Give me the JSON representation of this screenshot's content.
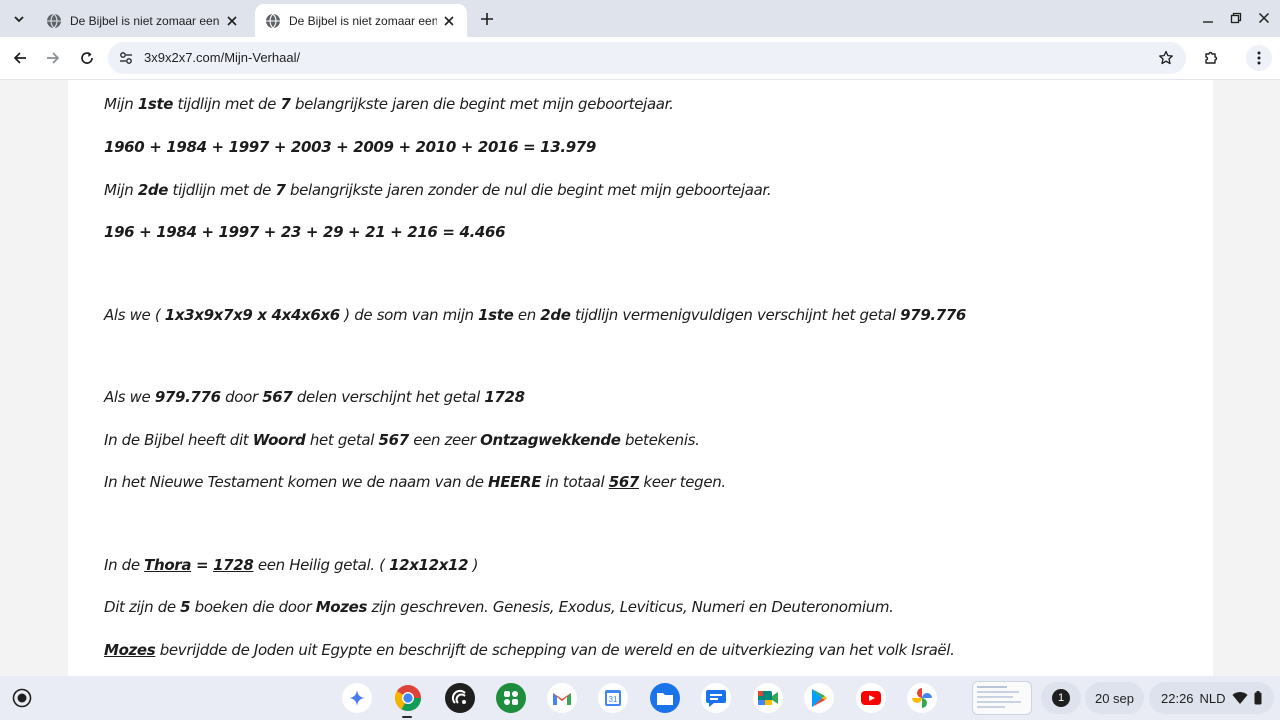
{
  "tabs": [
    {
      "title": "De Bijbel is niet zomaar een boek"
    },
    {
      "title": "De Bijbel is niet zomaar een boek"
    }
  ],
  "address": {
    "url": "3x9x2x7.com/Mijn-Verhaal/"
  },
  "shelf": {
    "date": "20 sep",
    "time": "22:26",
    "locale": "NLD",
    "notifications": "1",
    "calendar_day": "31"
  },
  "content": {
    "line1": {
      "a": "Mijn ",
      "b": "1ste",
      "c": " tijdlijn met de ",
      "d": "7",
      "e": " belangrijkste jaren die begint met mijn geboortejaar."
    },
    "line2": {
      "a": "1960 + 1984 + 1997 + 2003 + 2009 + 2010 + 2016 = 13.979"
    },
    "line3": {
      "a": "Mijn ",
      "b": "2de",
      "c": " tijdlijn met de ",
      "d": "7",
      "e": " belangrijkste jaren zonder de nul die begint met mijn geboortejaar."
    },
    "line4": {
      "a": "196 + 1984 + 1997 + 23 + 29 + 21 + 216 = 4.466"
    },
    "line5": {
      "a": "Als we ( ",
      "b": "1x3x9x7x9 x 4x4x6x6",
      "c": " ) de som van mijn ",
      "d": "1ste",
      "e": " en ",
      "f": "2de",
      "g": " tijdlijn vermenigvuldigen verschijnt het getal ",
      "h": "979.776"
    },
    "line6": {
      "a": "Als we ",
      "b": "979.776",
      "c": " door ",
      "d": "567",
      "e": " delen verschijnt het getal ",
      "f": "1728"
    },
    "line7": {
      "a": "In de Bijbel heeft dit ",
      "b": "Woord",
      "c": " het getal ",
      "d": "567",
      "e": " een zeer ",
      "f": "Ontzagwekkende",
      "g": " betekenis."
    },
    "line8": {
      "a": "In het Nieuwe Testament komen we de naam van de ",
      "b": "HEERE",
      "c": " in totaal ",
      "d": "567",
      "e": " keer tegen."
    },
    "line9": {
      "a": "In de ",
      "b": "Thora",
      "c": " = ",
      "d": "1728",
      "e": " een Heilig getal. ( ",
      "f": "12x12x12",
      "g": " )"
    },
    "line10": {
      "a": "Dit zijn de ",
      "b": "5",
      "c": " boeken die door ",
      "d": "Mozes",
      "e": " zijn geschreven. Genesis, Exodus, Leviticus, Numeri en Deuteronomium."
    },
    "line11": {
      "a": "Mozes",
      "b": " bevrijdde de Joden uit Egypte en beschrijft de schepping van de wereld en de uitverkiezing van het volk Israël."
    }
  },
  "colors": {
    "tabstrip": "#dfe3ec",
    "omnibox": "#eef1f8",
    "shelf": "#e9ecf4",
    "text": "#1c1c1c"
  }
}
